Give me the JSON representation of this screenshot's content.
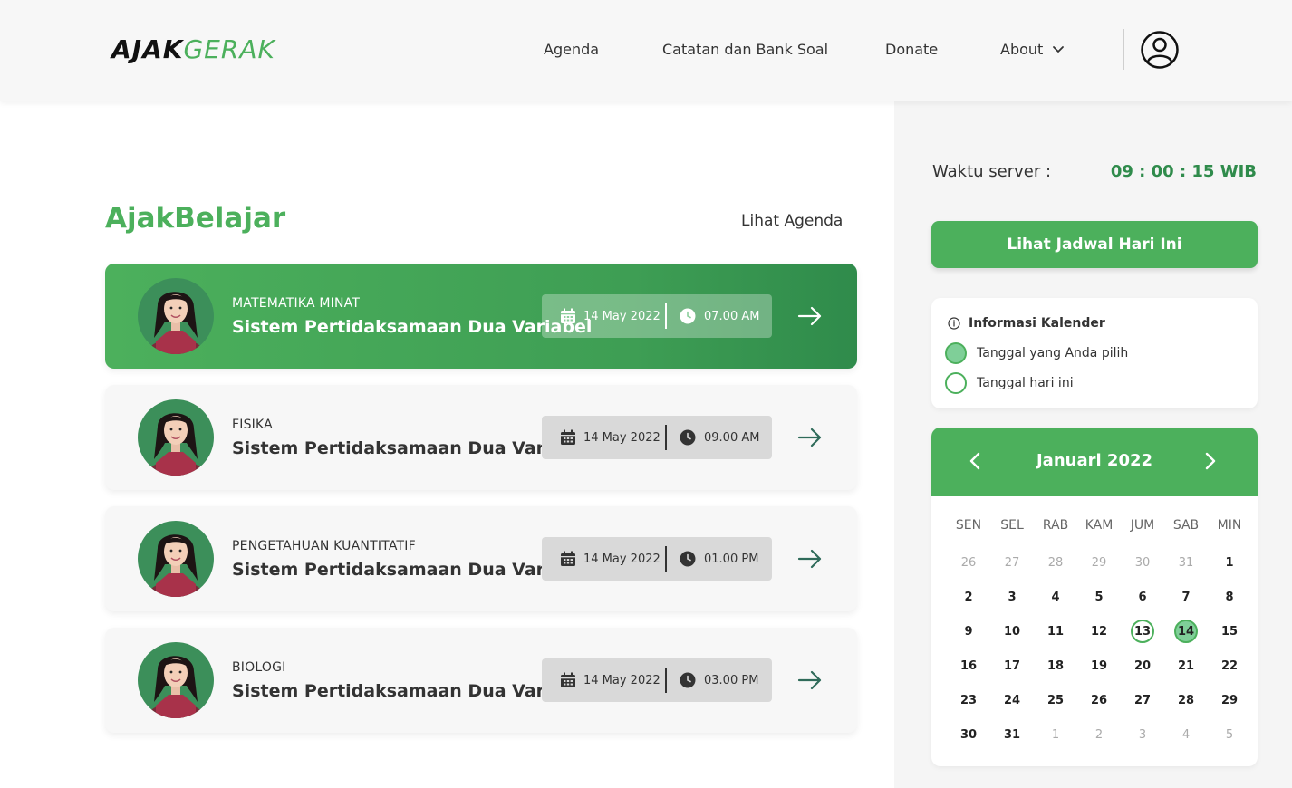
{
  "header": {
    "logo_part1": "AJAK",
    "logo_part2": "GERAK",
    "nav": [
      "Agenda",
      "Catatan dan Bank Soal",
      "Donate",
      "About"
    ]
  },
  "main": {
    "title": "AjakBelajar",
    "see_agenda": "Lihat Agenda",
    "cards": [
      {
        "subject": "MATEMATIKA MINAT",
        "title": "Sistem Pertidaksamaan Dua Variabel",
        "date": "14 May 2022",
        "time": "07.00 AM",
        "active": true
      },
      {
        "subject": "FISIKA",
        "title": "Sistem Pertidaksamaan Dua Variabel",
        "date": "14 May 2022",
        "time": "09.00 AM",
        "active": false
      },
      {
        "subject": "PENGETAHUAN KUANTITATIF",
        "title": "Sistem Pertidaksamaan Dua Variabel",
        "date": "14 May 2022",
        "time": "01.00 PM",
        "active": false
      },
      {
        "subject": "BIOLOGI",
        "title": "Sistem Pertidaksamaan Dua Variabel",
        "date": "14 May 2022",
        "time": "03.00 PM",
        "active": false
      }
    ]
  },
  "sidebar": {
    "server_label": "Waktu server :",
    "server_time": "09 : 00 : 15 WIB",
    "today_button": "Lihat Jadwal Hari Ini",
    "info_title": "Informasi Kalender",
    "legend_selected": "Tanggal yang Anda pilih",
    "legend_today": "Tanggal hari ini",
    "calendar": {
      "month": "Januari 2022",
      "weekdays": [
        "SEN",
        "SEL",
        "RAB",
        "KAM",
        "JUM",
        "SAB",
        "MIN"
      ],
      "weeks": [
        [
          [
            "26",
            "m"
          ],
          [
            "27",
            "m"
          ],
          [
            "28",
            "m"
          ],
          [
            "29",
            "m"
          ],
          [
            "30",
            "m"
          ],
          [
            "31",
            "m"
          ],
          [
            "1",
            "d"
          ]
        ],
        [
          [
            "2",
            "d"
          ],
          [
            "3",
            "d"
          ],
          [
            "4",
            "d"
          ],
          [
            "5",
            "d"
          ],
          [
            "6",
            "d"
          ],
          [
            "7",
            "d"
          ],
          [
            "8",
            "d"
          ]
        ],
        [
          [
            "9",
            "d"
          ],
          [
            "10",
            "d"
          ],
          [
            "11",
            "d"
          ],
          [
            "12",
            "d"
          ],
          [
            "13",
            "t"
          ],
          [
            "14",
            "s"
          ],
          [
            "15",
            "d"
          ]
        ],
        [
          [
            "16",
            "d"
          ],
          [
            "17",
            "d"
          ],
          [
            "18",
            "d"
          ],
          [
            "19",
            "d"
          ],
          [
            "20",
            "d"
          ],
          [
            "21",
            "d"
          ],
          [
            "22",
            "d"
          ]
        ],
        [
          [
            "23",
            "d"
          ],
          [
            "24",
            "d"
          ],
          [
            "25",
            "d"
          ],
          [
            "26",
            "d"
          ],
          [
            "27",
            "d"
          ],
          [
            "28",
            "d"
          ],
          [
            "29",
            "d"
          ]
        ],
        [
          [
            "30",
            "d"
          ],
          [
            "31",
            "d"
          ],
          [
            "1",
            "m"
          ],
          [
            "2",
            "m"
          ],
          [
            "3",
            "m"
          ],
          [
            "4",
            "m"
          ],
          [
            "5",
            "m"
          ]
        ]
      ]
    }
  },
  "colors": {
    "accent": "#4cb05c",
    "accent_dark": "#2f8b4b",
    "selected_fill": "#7fcf98"
  },
  "icons": [
    "user-icon",
    "chevron-down-icon",
    "calendar-icon",
    "clock-icon",
    "arrow-right-icon",
    "info-icon",
    "chevron-left-icon",
    "chevron-right-icon"
  ]
}
